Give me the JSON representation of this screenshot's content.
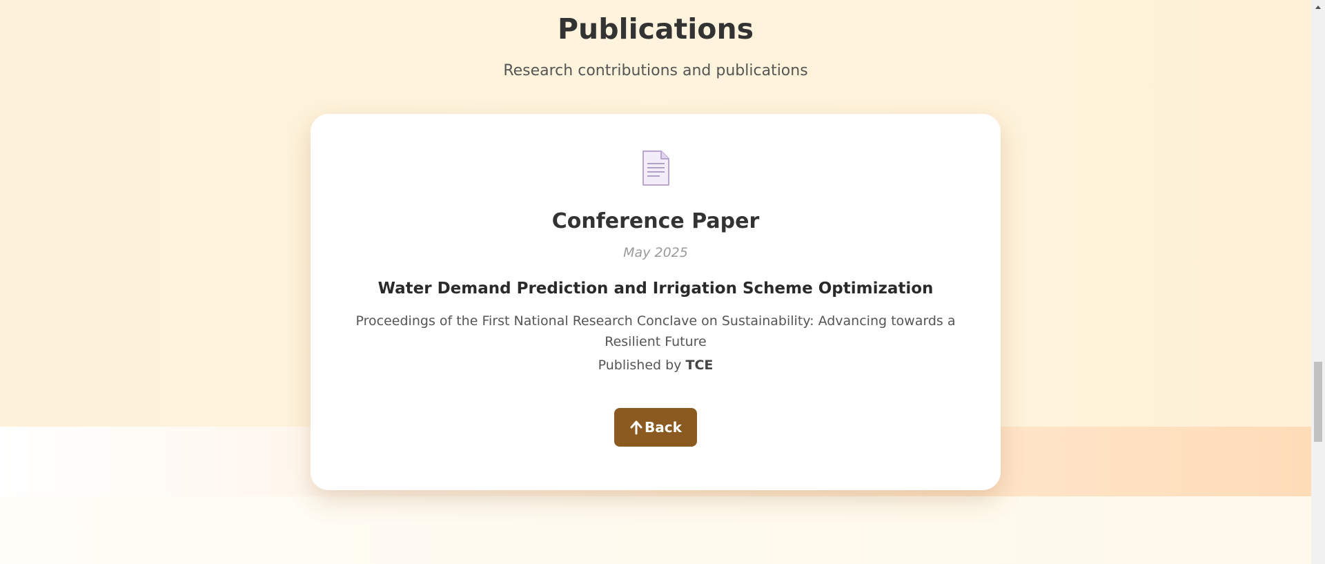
{
  "section": {
    "title": "Publications",
    "subtitle": "Research contributions and publications"
  },
  "publication": {
    "icon": "document-icon",
    "type": "Conference Paper",
    "date": "May 2025",
    "title": "Water Demand Prediction and Irrigation Scheme Optimization",
    "proceedings": "Proceedings of the First National Research Conclave on Sustainability: Advancing towards a Resilient Future",
    "published_by_label": "Published by",
    "publisher": "TCE"
  },
  "back_button": {
    "icon": "arrow-up-icon",
    "label": "Back",
    "color": "#8b5a20"
  },
  "colors": {
    "section_background": "#fef3dc",
    "card_background": "#ffffff"
  }
}
